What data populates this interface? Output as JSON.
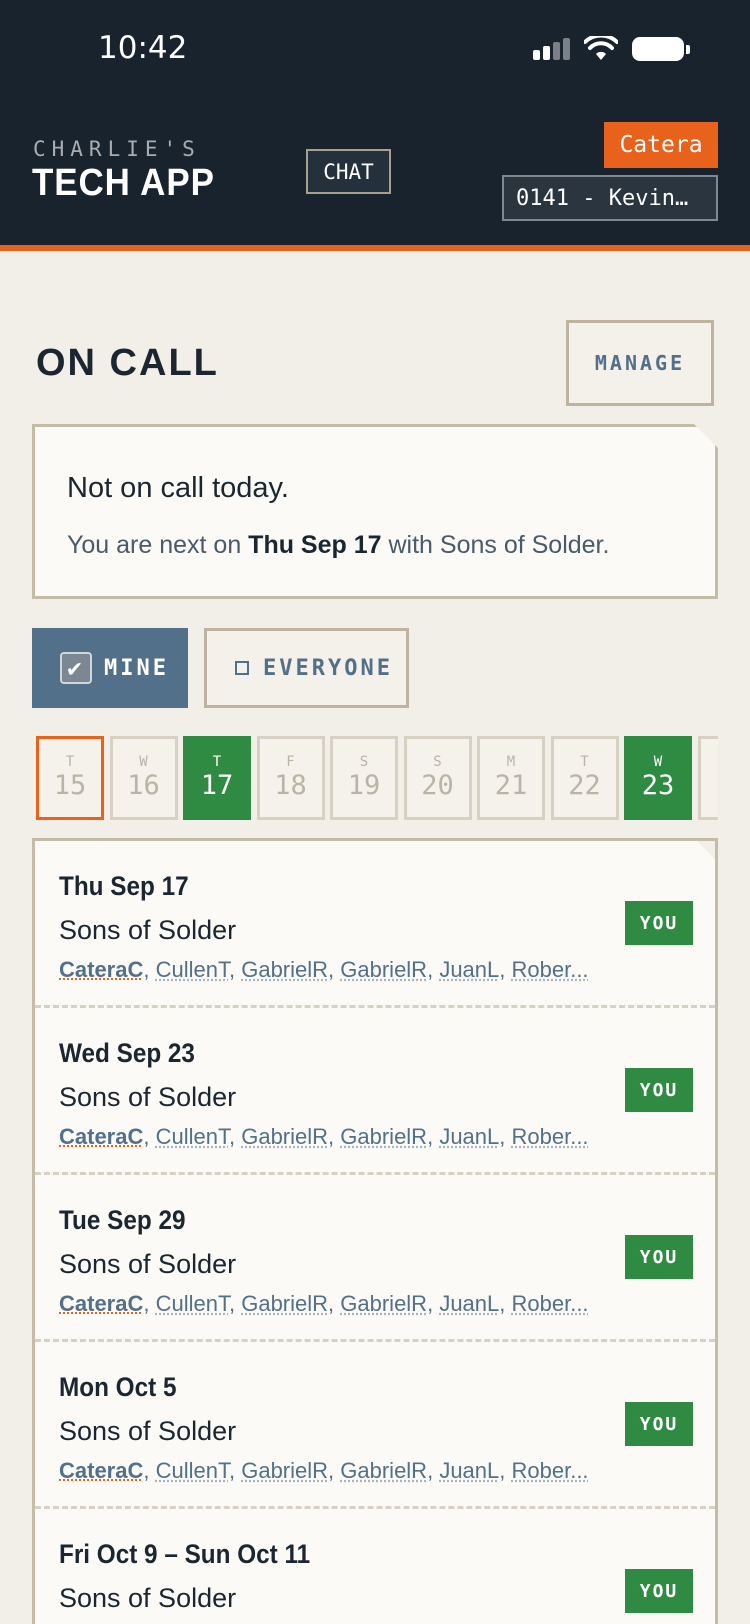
{
  "status_bar": {
    "time": "10:42"
  },
  "header": {
    "brand_line1": "CHARLIE'S",
    "brand_line2": "TECH APP",
    "chat_label": "CHAT",
    "user_badge": "Catera",
    "store_selector": "0141 - Kevin…"
  },
  "on_call": {
    "title": "ON CALL",
    "manage_label": "MANAGE",
    "status_primary": "Not on call today.",
    "status_secondary_prefix": "You are next on ",
    "status_secondary_date": "Thu Sep 17",
    "status_secondary_suffix": " with Sons of Solder."
  },
  "filters": {
    "mine_label": "MINE",
    "everyone_label": "EVERYONE",
    "mine_checked": true,
    "everyone_checked": false
  },
  "calendar": [
    {
      "dow": "T",
      "day": "15",
      "state": "today"
    },
    {
      "dow": "W",
      "day": "16",
      "state": "normal"
    },
    {
      "dow": "T",
      "day": "17",
      "state": "oncall"
    },
    {
      "dow": "F",
      "day": "18",
      "state": "normal"
    },
    {
      "dow": "S",
      "day": "19",
      "state": "normal"
    },
    {
      "dow": "S",
      "day": "20",
      "state": "normal"
    },
    {
      "dow": "M",
      "day": "21",
      "state": "normal"
    },
    {
      "dow": "T",
      "day": "22",
      "state": "normal"
    },
    {
      "dow": "W",
      "day": "23",
      "state": "oncall"
    },
    {
      "dow": "",
      "day": "",
      "state": "normal"
    }
  ],
  "schedule": [
    {
      "date": "Thu Sep 17",
      "team": "Sons of Solder",
      "members": [
        "CateraC",
        "CullenT",
        "GabrielR",
        "GabrielR",
        "JuanL",
        "Rober..."
      ],
      "badge": "YOU"
    },
    {
      "date": "Wed Sep 23",
      "team": "Sons of Solder",
      "members": [
        "CateraC",
        "CullenT",
        "GabrielR",
        "GabrielR",
        "JuanL",
        "Rober..."
      ],
      "badge": "YOU"
    },
    {
      "date": "Tue Sep 29",
      "team": "Sons of Solder",
      "members": [
        "CateraC",
        "CullenT",
        "GabrielR",
        "GabrielR",
        "JuanL",
        "Rober..."
      ],
      "badge": "YOU"
    },
    {
      "date": "Mon Oct 5",
      "team": "Sons of Solder",
      "members": [
        "CateraC",
        "CullenT",
        "GabrielR",
        "GabrielR",
        "JuanL",
        "Rober..."
      ],
      "badge": "YOU"
    },
    {
      "date": "Fri Oct 9 – Sun Oct 11",
      "team": "Sons of Solder",
      "members": [],
      "badge": "YOU"
    }
  ],
  "colors": {
    "header_bg": "#19232e",
    "accent_orange": "#e8621c",
    "slate_blue": "#52708a",
    "on_call_green": "#2e8b41",
    "page_bg": "#f2eee8"
  }
}
